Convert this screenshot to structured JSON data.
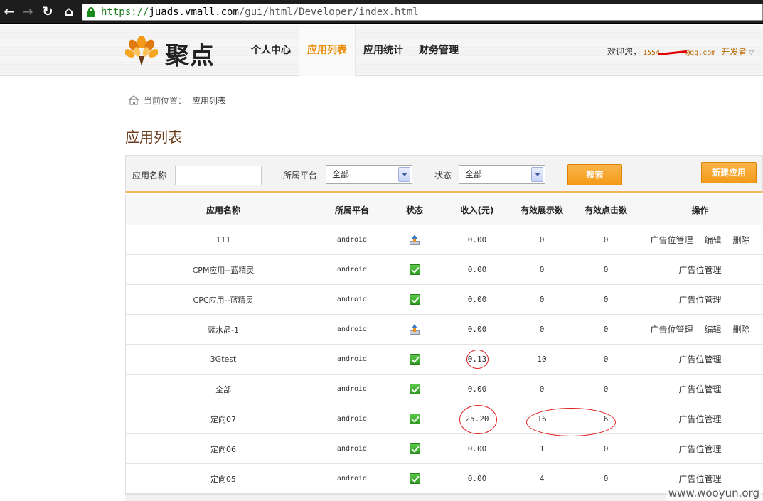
{
  "browser": {
    "url_scheme": "https://",
    "url_host": "juads.vmall.com",
    "url_path": "/gui/html/Developer/index.html"
  },
  "header": {
    "brand": "聚点",
    "nav": [
      "个人中心",
      "应用列表",
      "应用统计",
      "财务管理"
    ],
    "active_nav": "应用列表",
    "welcome": "欢迎您，",
    "email_prefix": "1554",
    "email_suffix": "@qq.com",
    "role": "开发者"
  },
  "breadcrumb": {
    "label": "当前位置：",
    "current": "应用列表"
  },
  "page_title": "应用列表",
  "filter": {
    "name_label": "应用名称",
    "name_value": "",
    "platform_label": "所属平台",
    "platform_value": "全部",
    "status_label": "状态",
    "status_value": "全部",
    "search_button": "搜索",
    "new_button": "新建应用"
  },
  "table": {
    "headers": {
      "name": "应用名称",
      "platform": "所属平台",
      "status": "状态",
      "income": "收入(元)",
      "impressions": "有效展示数",
      "clicks": "有效点击数",
      "ops": "操作"
    },
    "ops_labels": {
      "ad_manage": "广告位管理",
      "edit": "编辑",
      "delete": "删除"
    },
    "rows": [
      {
        "name": "111",
        "platform": "android",
        "status": "pending-upload-icon",
        "income": "0.00",
        "impressions": "0",
        "clicks": "0",
        "full_ops": true
      },
      {
        "name": "CPM应用--蓝精灵",
        "platform": "android",
        "status": "approved-check-icon",
        "income": "0.00",
        "impressions": "0",
        "clicks": "0",
        "full_ops": false
      },
      {
        "name": "CPC应用--蓝精灵",
        "platform": "android",
        "status": "approved-check-icon",
        "income": "0.00",
        "impressions": "0",
        "clicks": "0",
        "full_ops": false
      },
      {
        "name": "蓝水晶-1",
        "platform": "android",
        "status": "pending-upload-icon",
        "income": "0.00",
        "impressions": "0",
        "clicks": "0",
        "full_ops": true
      },
      {
        "name": "3Gtest",
        "platform": "android",
        "status": "approved-check-icon",
        "income": "0.13",
        "impressions": "10",
        "clicks": "0",
        "full_ops": false
      },
      {
        "name": "全部",
        "platform": "android",
        "status": "approved-check-icon",
        "income": "0.00",
        "impressions": "0",
        "clicks": "0",
        "full_ops": false
      },
      {
        "name": "定向07",
        "platform": "android",
        "status": "approved-check-icon",
        "income": "25.20",
        "impressions": "16",
        "clicks": "6",
        "full_ops": false
      },
      {
        "name": "定向06",
        "platform": "android",
        "status": "approved-check-icon",
        "income": "0.00",
        "impressions": "1",
        "clicks": "0",
        "full_ops": false
      },
      {
        "name": "定向05",
        "platform": "android",
        "status": "approved-check-icon",
        "income": "0.00",
        "impressions": "4",
        "clicks": "0",
        "full_ops": false
      }
    ]
  },
  "watermark": "www.wooyun.org",
  "colors": {
    "accent": "#e88a00",
    "button": "#f39b18",
    "annotation": "#e02020"
  }
}
